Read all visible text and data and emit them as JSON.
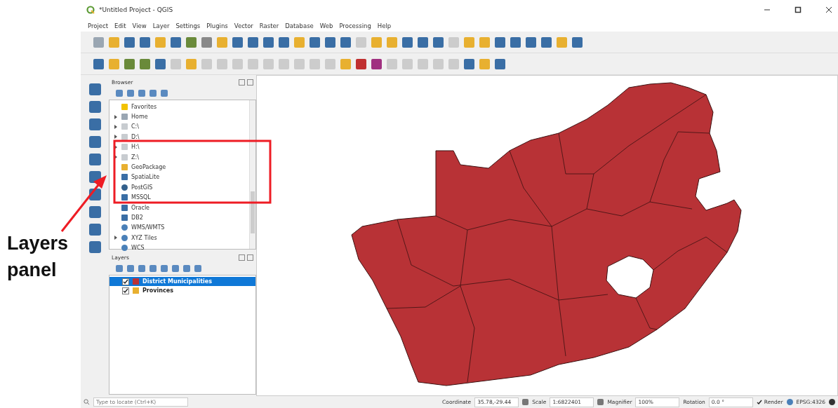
{
  "window": {
    "title": "*Untitled Project - QGIS"
  },
  "menu": [
    "Project",
    "Edit",
    "View",
    "Layer",
    "Settings",
    "Plugins",
    "Vector",
    "Raster",
    "Database",
    "Web",
    "Processing",
    "Help"
  ],
  "annotation": {
    "label": "Layers panel"
  },
  "browser": {
    "title": "Browser",
    "items": [
      {
        "label": "Favorites",
        "kind": "star",
        "expandable": false
      },
      {
        "label": "Home",
        "kind": "folder",
        "expandable": true
      },
      {
        "label": "C:\\",
        "kind": "drive",
        "expandable": true
      },
      {
        "label": "D:\\",
        "kind": "drive",
        "expandable": true
      },
      {
        "label": "H:\\",
        "kind": "drive",
        "expandable": true
      },
      {
        "label": "Z:\\",
        "kind": "drive",
        "expandable": true
      },
      {
        "label": "GeoPackage",
        "kind": "geopackage",
        "expandable": false
      },
      {
        "label": "SpatiaLite",
        "kind": "feather",
        "expandable": false
      },
      {
        "label": "PostGIS",
        "kind": "elephant",
        "expandable": false
      },
      {
        "label": "MSSQL",
        "kind": "db",
        "expandable": false
      },
      {
        "label": "Oracle",
        "kind": "db",
        "expandable": false
      },
      {
        "label": "DB2",
        "kind": "db",
        "expandable": false
      },
      {
        "label": "WMS/WMTS",
        "kind": "globe",
        "expandable": false
      },
      {
        "label": "XYZ Tiles",
        "kind": "globe",
        "expandable": true
      },
      {
        "label": "WCS",
        "kind": "globe",
        "expandable": false
      }
    ]
  },
  "layers": {
    "title": "Layers",
    "items": [
      {
        "name": "District Municipalities",
        "checked": true,
        "selected": true,
        "color": "#b83236"
      },
      {
        "name": "Provinces",
        "checked": true,
        "selected": false,
        "color": "#e8b030"
      }
    ]
  },
  "status_bar": {
    "locator_placeholder": "Type to locate (Ctrl+K)",
    "coordinate_label": "Coordinate",
    "coordinate": "35.78,-29.44",
    "scale_label": "Scale",
    "scale": "1:6822401",
    "magnifier_label": "Magnifier",
    "magnifier": "100%",
    "rotation_label": "Rotation",
    "rotation": "0.0 °",
    "render_label": "Render",
    "render": true,
    "crs": "EPSG:4326"
  }
}
